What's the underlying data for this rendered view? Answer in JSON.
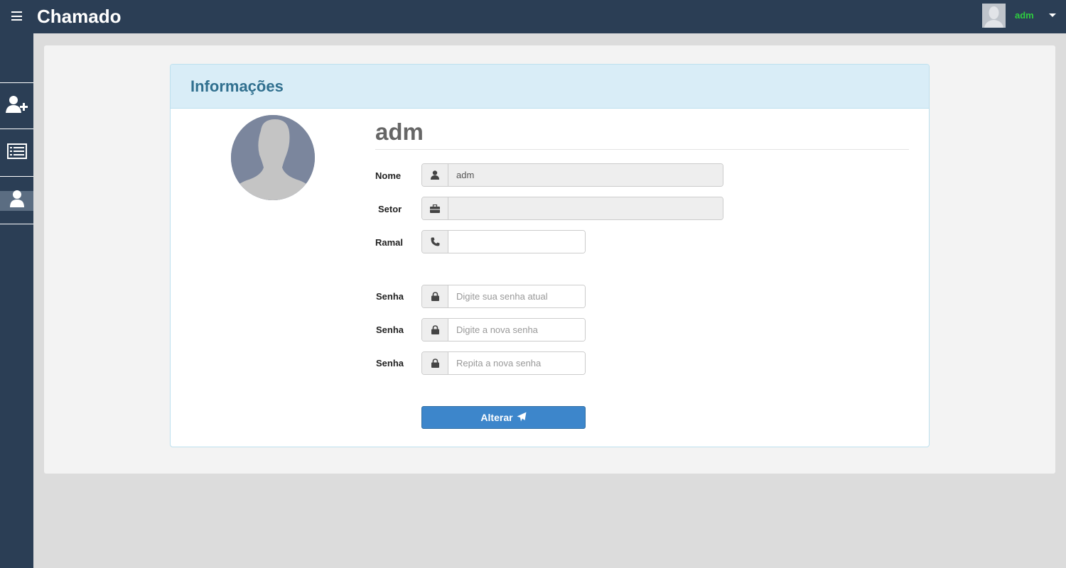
{
  "app": {
    "title": "Chamado"
  },
  "header": {
    "user_name": "adm",
    "icons": [
      "menu-icon",
      "user-avatar",
      "chevron-down-icon"
    ]
  },
  "sidebar": {
    "items": [
      {
        "icon": "user-plus-icon",
        "label": ""
      },
      {
        "icon": "list-icon",
        "label": ""
      },
      {
        "icon": "user-icon",
        "label": "",
        "active": true
      }
    ]
  },
  "panel": {
    "title": "Informações"
  },
  "profile": {
    "name": "adm",
    "fields": {
      "nome": {
        "label": "Nome",
        "value": "adm",
        "icon": "user-icon"
      },
      "setor": {
        "label": "Setor",
        "value": "",
        "icon": "briefcase-icon"
      },
      "ramal": {
        "label": "Ramal",
        "value": "",
        "icon": "phone-icon"
      }
    },
    "passwords": [
      {
        "label": "Senha",
        "placeholder": "Digite sua senha atual",
        "icon": "lock-icon"
      },
      {
        "label": "Senha",
        "placeholder": "Digite a nova senha",
        "icon": "lock-icon"
      },
      {
        "label": "Senha",
        "placeholder": "Repita a nova senha",
        "icon": "lock-icon"
      }
    ],
    "submit_label": "Alterar"
  },
  "colors": {
    "topbar": "#2b3e55",
    "panel_head": "#d9edf7",
    "panel_title": "#31708f",
    "user_name": "#2ecc40",
    "button": "#3d86cb"
  }
}
